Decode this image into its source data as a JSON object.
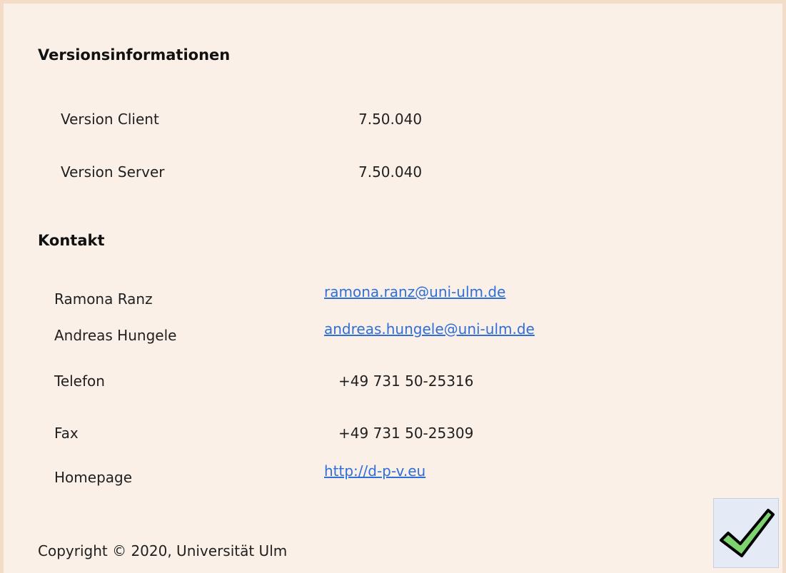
{
  "version_section": {
    "heading": "Versionsinformationen",
    "client_label": "Version Client",
    "client_value": "7.50.040",
    "server_label": "Version Server",
    "server_value": "7.50.040"
  },
  "contact_section": {
    "heading": "Kontakt",
    "person1_name": "Ramona Ranz",
    "person1_email": "ramona.ranz@uni-ulm.de",
    "person2_name": "Andreas Hungele",
    "person2_email": "andreas.hungele@uni-ulm.de",
    "phone_label": "Telefon",
    "phone_value": "+49 731 50-25316",
    "fax_label": "Fax",
    "fax_value": "+49 731 50-25309",
    "homepage_label": "Homepage",
    "homepage_url": "http://d-p-v.eu"
  },
  "footer": {
    "copyright": "Copyright ©  2020, Universität Ulm"
  },
  "ok_button": {
    "icon": "checkmark-icon",
    "fill_color": "#7dd36d",
    "outline_color": "#000000"
  }
}
